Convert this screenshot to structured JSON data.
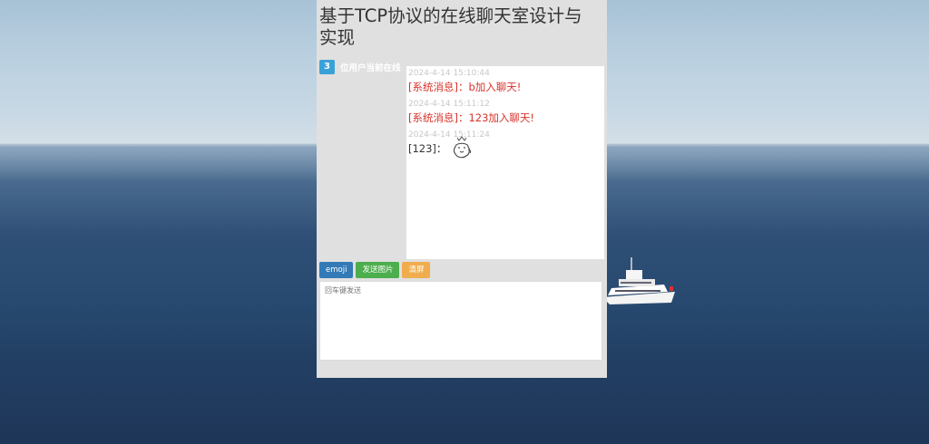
{
  "page": {
    "title": "基于TCP协议的在线聊天室设计与实现"
  },
  "online": {
    "count": "3",
    "label": "位用户当前在线"
  },
  "messages": [
    {
      "time": "2024-4-14 15:10:44",
      "text": "[系统消息]：b加入聊天!"
    },
    {
      "time": "2024-4-14 15:11:12",
      "text": "[系统消息]：123加入聊天!"
    },
    {
      "time": "2024-4-14 15:11:24",
      "sender": "[123]："
    }
  ],
  "toolbar": {
    "emoji_label": "emoji",
    "image_label": "发送图片",
    "clear_label": "清屏"
  },
  "input": {
    "placeholder": "回车键发送"
  },
  "colors": {
    "system_message": "#d9332b",
    "badge": "#3aa0d8",
    "btn_emoji": "#337ab7",
    "btn_image": "#4cae4c",
    "btn_clear": "#f0ad4e"
  },
  "icons": {
    "sticker": "emoji-sticker-icon"
  }
}
